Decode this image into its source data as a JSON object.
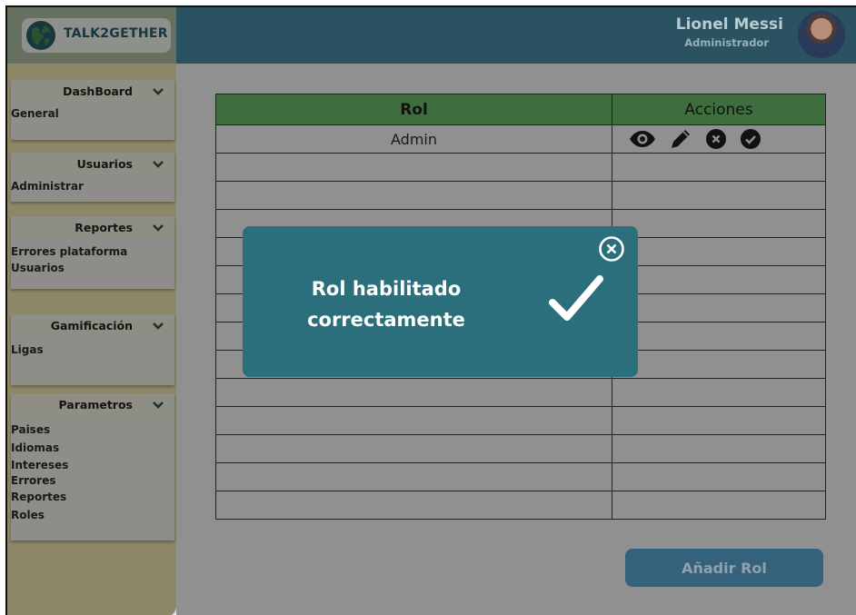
{
  "brand": {
    "name": "TALK2GETHER"
  },
  "user": {
    "name": "Lionel Messi",
    "role": "Administrador"
  },
  "sidebar": {
    "sections": [
      {
        "title": "DashBoard",
        "items": [
          "General"
        ]
      },
      {
        "title": "Usuarios",
        "items": [
          "Administrar"
        ]
      },
      {
        "title": "Reportes",
        "items": [
          "Errores plataforma",
          "Usuarios"
        ]
      },
      {
        "title": "Gamificación",
        "items": [
          "Ligas"
        ]
      },
      {
        "title": "Parametros",
        "items": [
          "Paises",
          "Idiomas",
          "Intereses",
          "Errores",
          "Reportes",
          "Roles"
        ]
      }
    ]
  },
  "table": {
    "headers": {
      "rol": "Rol",
      "acciones": "Acciones"
    },
    "rows": [
      {
        "rol": "Admin"
      }
    ]
  },
  "actions": {
    "add_role": "Añadir Rol"
  },
  "modal": {
    "line1": "Rol habilitado",
    "line2": "correctamente"
  },
  "icons": [
    "globe-logo-icon",
    "chevron-down-icon",
    "eye-icon",
    "pencil-icon",
    "close-circle-icon",
    "check-circle-icon",
    "close-circle-outline-icon",
    "checkmark-icon"
  ],
  "colors": {
    "header": "#2a5261",
    "sidebar": "#eae3a6",
    "table_header": "#3e6e3e",
    "modal": "#2a6f7b",
    "button": "#34627c"
  }
}
